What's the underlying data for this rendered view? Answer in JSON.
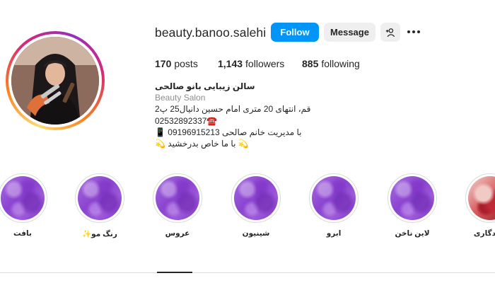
{
  "profile": {
    "username": "beauty.banoo.salehi",
    "follow_label": "Follow",
    "message_label": "Message"
  },
  "stats": {
    "posts_count": "170",
    "posts_label": "posts",
    "followers_count": "1,143",
    "followers_label": "followers",
    "following_count": "885",
    "following_label": "following"
  },
  "bio": {
    "name": "سالن زیبایی بانو صالحی",
    "category": "Beauty Salon",
    "address": "قم، انتهای 20 متری امام حسین دانیال25 پ2",
    "phone": "02532892337☎️",
    "manager": "با مدیریت خانم صالحی 09196915213 📱",
    "tagline": "💫 با ما خاص بدرخشید 💫"
  },
  "highlights": [
    {
      "label": "بافت"
    },
    {
      "label": "رنگ مو✨"
    },
    {
      "label": "عروس"
    },
    {
      "label": "شینیون"
    },
    {
      "label": "ابرو"
    },
    {
      "label": "لاین ناخن"
    },
    {
      "label": "ماندگاری"
    }
  ],
  "icons": {
    "add_user": "person-plus-icon",
    "more": "more-options-icon"
  },
  "colors": {
    "follow_button": "#0095f6",
    "secondary_button": "#efefef",
    "highlight_purple": "#8b44d0"
  }
}
